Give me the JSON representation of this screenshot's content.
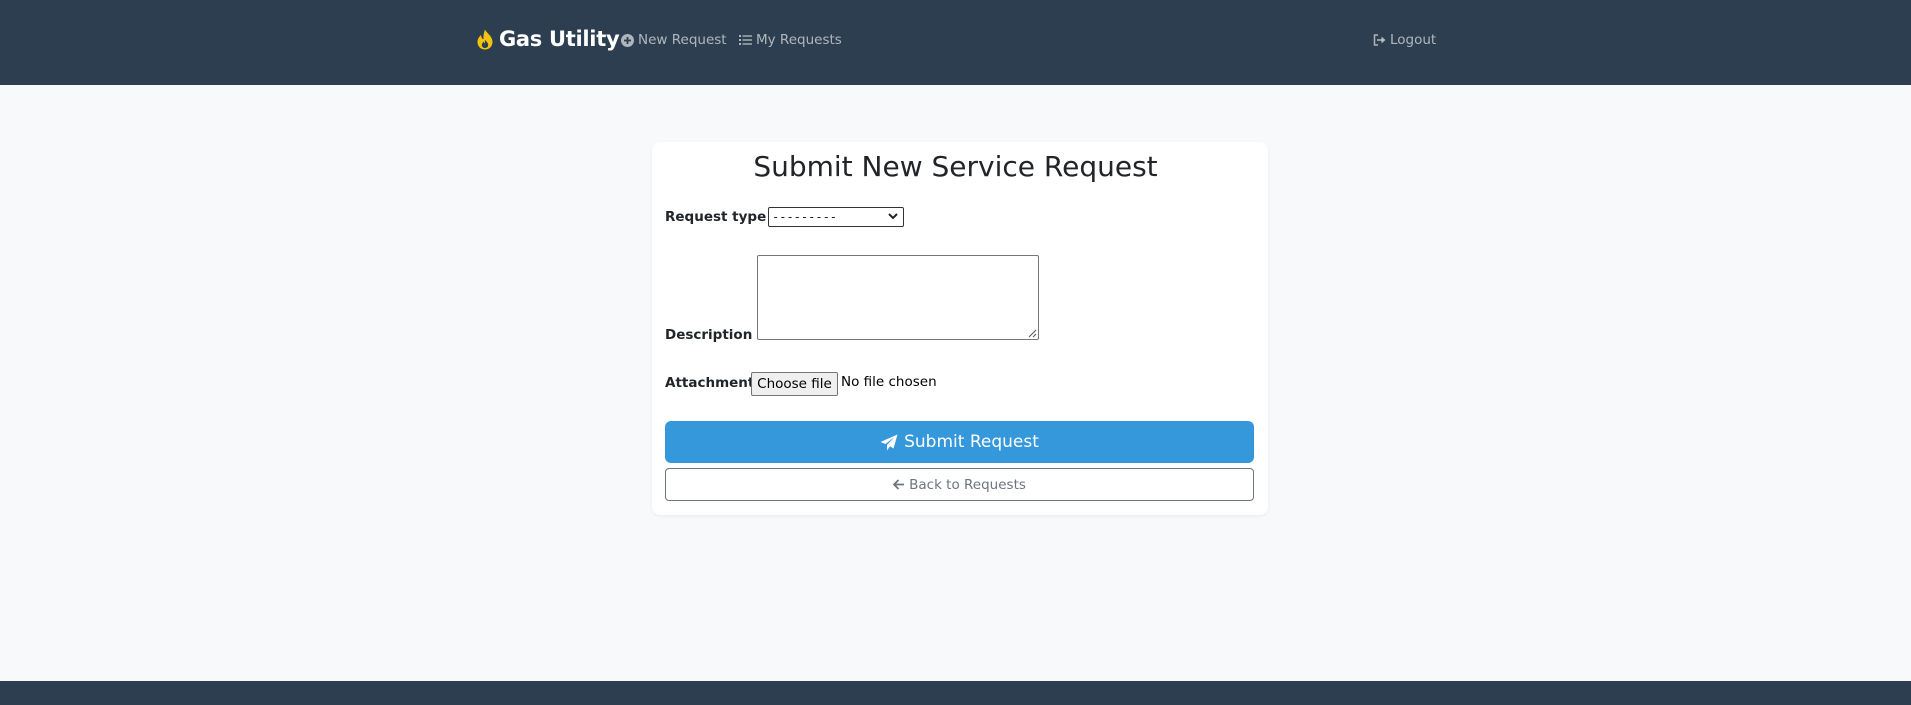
{
  "navbar": {
    "brand": "Gas Utility",
    "brand_icon": "fire-icon",
    "links": [
      {
        "label": "New Request",
        "icon": "plus-circle-icon"
      },
      {
        "label": "My Requests",
        "icon": "list-icon"
      }
    ],
    "logout": {
      "label": "Logout",
      "icon": "sign-out-icon"
    }
  },
  "form": {
    "title": "Submit New Service Request",
    "request_type": {
      "label": "Request type",
      "required_marker": "*",
      "selected_value": "---------"
    },
    "description": {
      "label": "Description",
      "required_marker": "*",
      "value": ""
    },
    "attachment": {
      "label": "Attachment",
      "button_label": "Choose file",
      "status": "No file chosen"
    },
    "submit": {
      "label": "Submit Request",
      "icon": "paper-plane-icon"
    },
    "back": {
      "label": "Back to Requests",
      "icon": "arrow-left-icon"
    }
  },
  "colors": {
    "navbar_bg": "#2c3e50",
    "primary": "#3498db",
    "brand_icon": "#f1c40f",
    "required": "#e74c3c",
    "page_bg": "#f8f9fa"
  }
}
